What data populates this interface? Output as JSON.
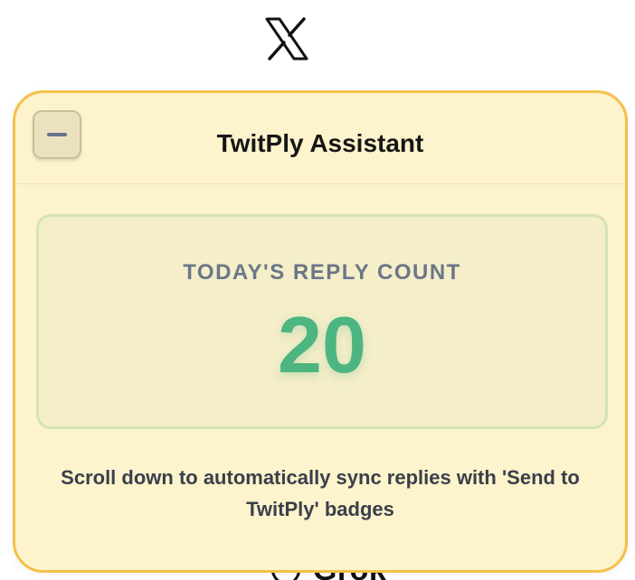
{
  "background": {
    "logo_icon": "x-logo-icon",
    "obscured_text": "Grok"
  },
  "panel": {
    "title": "TwitPly Assistant",
    "minimize_icon": "minus-icon",
    "count_card": {
      "label": "TODAY'S REPLY COUNT",
      "value": "20"
    },
    "help_text": "Scroll down to automatically sync replies with 'Send to TwitPly' badges"
  },
  "colors": {
    "panel_background": "#fdf3cc",
    "panel_border": "#f2c14a",
    "count_value": "#4db57f",
    "count_label": "#6b7688",
    "card_border": "#d5e3b6"
  }
}
